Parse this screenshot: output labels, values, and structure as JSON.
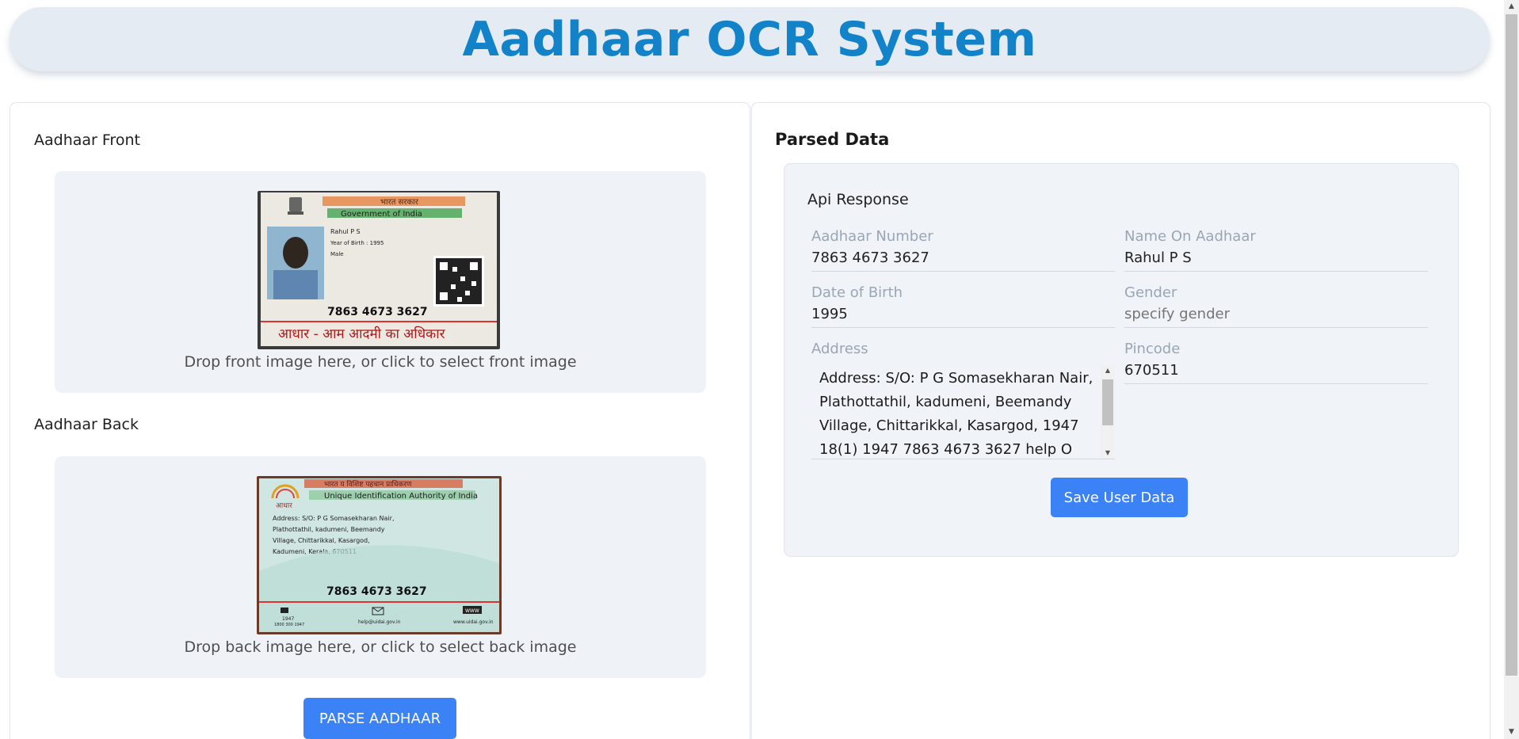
{
  "header": {
    "title": "Aadhaar OCR System"
  },
  "upload": {
    "front_label": "Aadhaar Front",
    "front_drop_text": "Drop front image here, or click to select front image",
    "back_label": "Aadhaar Back",
    "back_drop_text": "Drop back image here, or click to select back image",
    "parse_button": "PARSE AADHAAR",
    "front_card": {
      "header_hindi": "भारत सरकार",
      "header_english": "Government of India",
      "name": "Rahul P S",
      "yob": "Year of Birth : 1995",
      "gender": "Male",
      "number": "7863 4673 3627",
      "footer_hindi": "आधार - आम आदमी का अधिकार"
    },
    "back_card": {
      "header_hindi": "भारत य विशिष्ट पहचान प्राधिकरण",
      "header_english": "Unique Identification Authority of India",
      "logo_text": "आधार",
      "address_lines": [
        "Address: S/O: P G Somasekharan Nair,",
        "Plathottathil, kadumeni, Beemandy",
        "Village, Chittarikkal, Kasargod,",
        "Kadumeni, Kerala, 670511"
      ],
      "number": "7863 4673 3627",
      "footer_phone": "1947",
      "footer_phone_alt": "1800 300 1947",
      "footer_email": "help@uidai.gov.in",
      "footer_web_badge": "WWW",
      "footer_web": "www.uidai.gov.in"
    }
  },
  "parsed": {
    "title": "Parsed Data",
    "api_title": "Api Response",
    "aadhaar_number_label": "Aadhaar Number",
    "aadhaar_number": "7863 4673 3627",
    "name_label": "Name On Aadhaar",
    "name": "Rahul P S",
    "dob_label": "Date of Birth",
    "dob": "1995",
    "gender_label": "Gender",
    "gender_placeholder": "specify gender",
    "address_label": "Address",
    "address": "Address: S/O: P G Somasekharan Nair, Plathottathil, kadumeni, Beemandy Village, Chittarikkal, Kasargod, 1947 18(1) 1947 7863 4673 3627 help O",
    "pincode_label": "Pincode",
    "pincode": "670511",
    "save_button": "Save User Data"
  },
  "colors": {
    "accent": "#3b82f6",
    "title": "#1282c9",
    "header_bg": "#e5ebf3"
  }
}
